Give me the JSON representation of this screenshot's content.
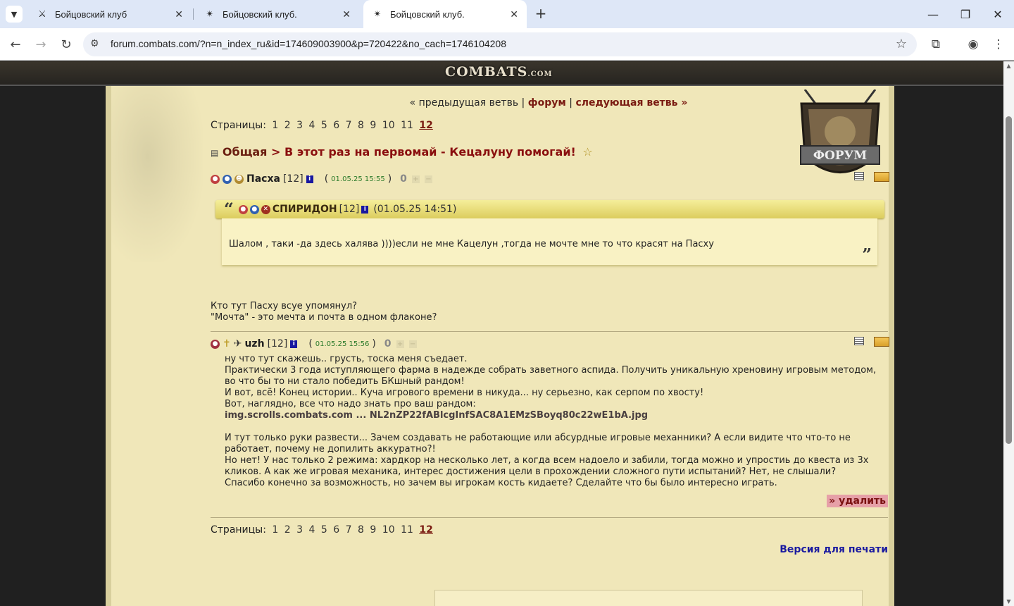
{
  "browser": {
    "tabs": [
      {
        "title": "Бойцовский клуб",
        "active": false
      },
      {
        "title": "Бойцовский клуб.",
        "active": false
      },
      {
        "title": "Бойцовский клуб.",
        "active": true
      }
    ],
    "url": "forum.combats.com/?n=n_index_ru&id=174609003900&p=720422&no_cach=1746104208"
  },
  "site": {
    "logo": "COMBATS",
    "logo_suffix": ".COM",
    "emblem_label": "ФОРУМ"
  },
  "nav": {
    "prev": "« предыдущая ветвь",
    "sep": "|",
    "forum": "форум",
    "next": "следующая ветвь »"
  },
  "pagination": {
    "label": "Страницы:",
    "pages": [
      "1",
      "2",
      "3",
      "4",
      "5",
      "6",
      "7",
      "8",
      "9",
      "10",
      "11",
      "12"
    ],
    "current": "12"
  },
  "topic": {
    "category": "Общая",
    "separator": ">",
    "title": "В этот раз на первомай - Кецалуну помогай!",
    "star": "☆"
  },
  "post1": {
    "nick": "Пасха",
    "level": "[12]",
    "info": "i",
    "date": "01.05.25 15:55",
    "score": "0",
    "quote": {
      "nick": "СПИРИДОН",
      "level": "[12]",
      "date": "(01.05.25 14:51)",
      "text": "Шалом , таки -да здесь халява ))))если не мне Кацелун ,тогда не мочте мне то что красят на Пасху"
    },
    "lines": [
      "Кто тут Пасху всуе упомянул?",
      "\"Мочта\" - это мечта и почта в одном флаконе?"
    ]
  },
  "post2": {
    "nick": "uzh",
    "level": "[12]",
    "info": "i",
    "date": "01.05.25 15:56",
    "score": "0",
    "lines": [
      "ну что тут скажешь.. грусть, тоска меня съедает.",
      "Практически 3 года иступляющего фарма в надежде собрать заветного аспида. Получить уникальную хреновину игровым методом,",
      "во что бы то ни стало победить БКшный рандом!",
      "И вот, всё! Конец истории.. Куча игрового времени в никуда... ну серьезно, как серпом по хвосту!",
      "Вот, наглядно, все что надо знать про ваш рандом:"
    ],
    "link": "img.scrolls.combats.com ... NL2nZP22fABlcgInfSAC8A1EMzSBoyq80c22wE1bA.jpg",
    "lines2": [
      "И тут только руки развести... Зачем создавать не работающие или абсурдные игровые механники? А если видите что что-то не",
      "работает, почему не допилить аккуратно?!",
      "Но нет! У нас только 2 режима: хардкор на несколько лет, а когда всем надоело и забили, тогда можно и упростиь до квеста из 3х",
      "кликов. А как же игровая механика, интерес достижения цели в прохождении сложного пути испытаний? Нет, не слышали?",
      "Спасибо конечно за возможность, но зачем вы игрокам кость кидаете? Сделайте что бы было интересно играть."
    ],
    "delete": "» удалить"
  },
  "print": "Версия для печати"
}
